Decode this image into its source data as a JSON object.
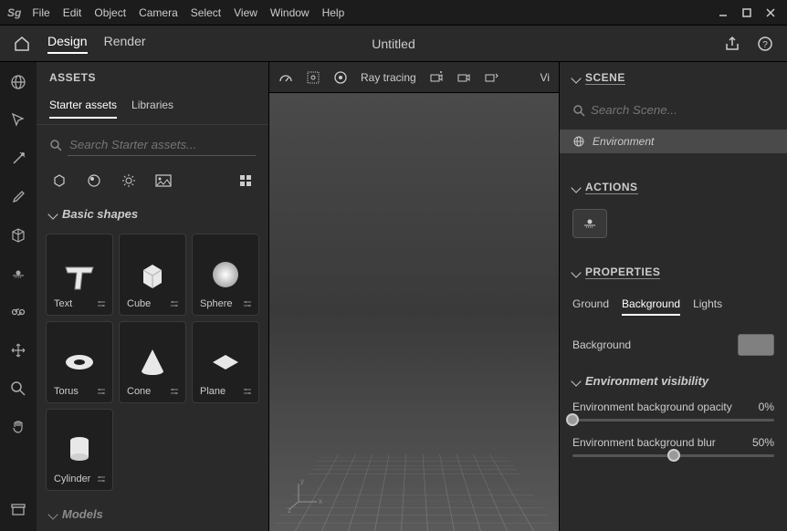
{
  "menu": [
    "File",
    "Edit",
    "Object",
    "Camera",
    "Select",
    "View",
    "Window",
    "Help"
  ],
  "app_logo": "Sg",
  "tabs": {
    "design": "Design",
    "render": "Render"
  },
  "doc_title": "Untitled",
  "assets": {
    "header": "ASSETS",
    "tabs": {
      "starter": "Starter assets",
      "libraries": "Libraries"
    },
    "search_placeholder": "Search Starter assets...",
    "section_shapes": "Basic shapes",
    "shapes": [
      "Text",
      "Cube",
      "Sphere",
      "Torus",
      "Cone",
      "Plane",
      "Cylinder"
    ],
    "section_models": "Models"
  },
  "viewport": {
    "raytracing": "Ray tracing",
    "view_partial": "Vi"
  },
  "scene": {
    "header": "SCENE",
    "search_placeholder": "Search Scene...",
    "item": "Environment"
  },
  "actions": {
    "header": "ACTIONS"
  },
  "properties": {
    "header": "PROPERTIES",
    "tabs": {
      "ground": "Ground",
      "background": "Background",
      "lights": "Lights"
    },
    "background_label": "Background",
    "env_visibility": "Environment visibility",
    "opacity_label": "Environment background opacity",
    "opacity_value": "0%",
    "opacity_pct": 0,
    "blur_label": "Environment background blur",
    "blur_value": "50%",
    "blur_pct": 50
  }
}
